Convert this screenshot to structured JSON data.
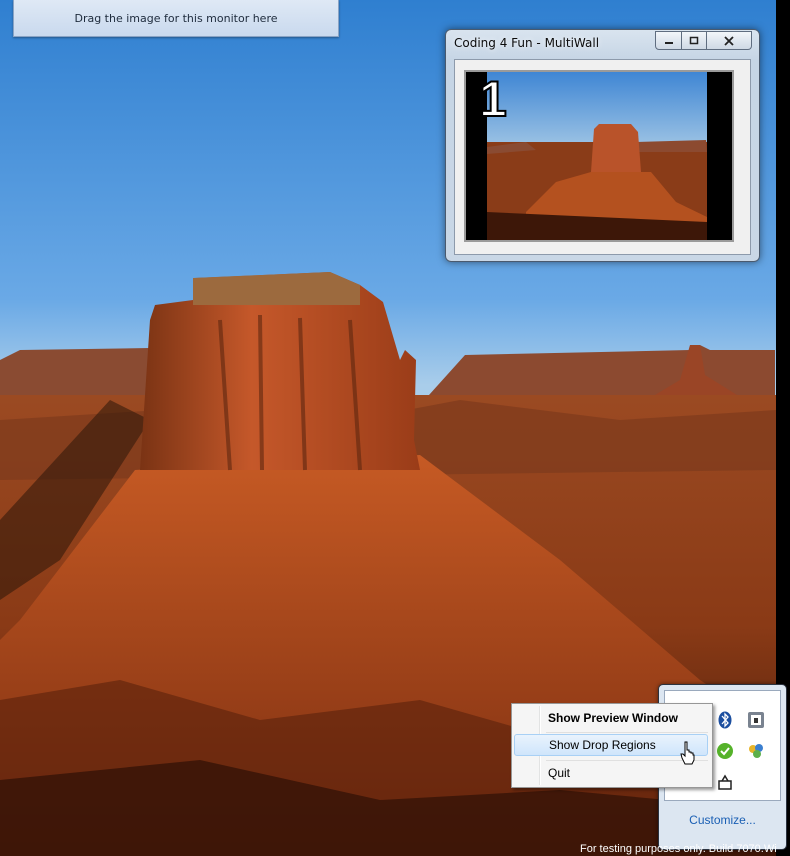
{
  "drop_banner": {
    "text": "Drag the image for this monitor here"
  },
  "preview_window": {
    "title": "Coding 4 Fun - MultiWall",
    "monitor_number": "1"
  },
  "context_menu": {
    "items": [
      {
        "label": "Show Preview Window",
        "bold": true
      },
      {
        "label": "Show Drop Regions",
        "highlighted": true
      },
      {
        "label": "Quit"
      }
    ]
  },
  "tray": {
    "customize_label": "Customize...",
    "icons": [
      "bluetooth-icon",
      "safely-remove-hardware-icon",
      "multiwall-tray-icon",
      "network-share-icon",
      "action-center-icon"
    ]
  },
  "watermark": "For testing purposes only. Build 7070.Wi",
  "colors": {
    "menu_highlight": "#cfe5fb",
    "link": "#1a5fb4"
  }
}
